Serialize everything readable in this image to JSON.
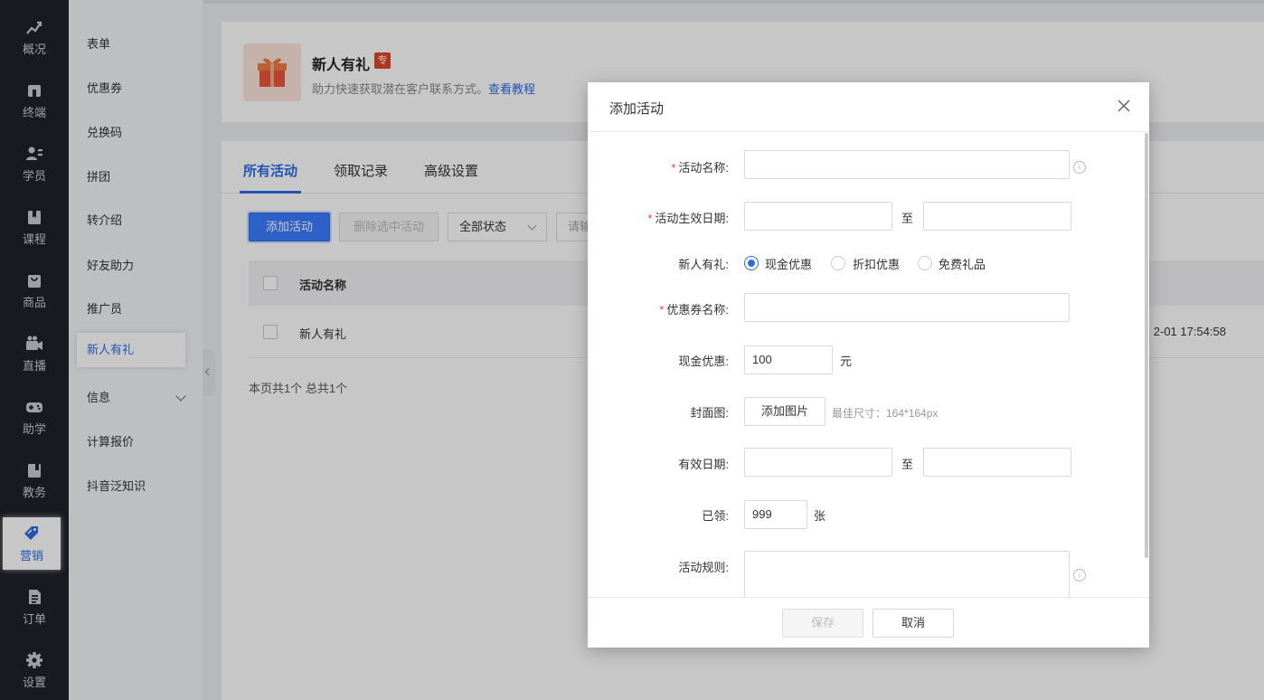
{
  "nav": {
    "items": [
      {
        "label": "概况",
        "icon": "chart-trend-icon"
      },
      {
        "label": "终端",
        "icon": "terminal-icon"
      },
      {
        "label": "学员",
        "icon": "users-icon"
      },
      {
        "label": "课程",
        "icon": "book-icon"
      },
      {
        "label": "商品",
        "icon": "bag-icon"
      },
      {
        "label": "直播",
        "icon": "video-icon"
      },
      {
        "label": "助学",
        "icon": "gamepad-icon"
      },
      {
        "label": "教务",
        "icon": "briefcase-icon"
      },
      {
        "label": "营销",
        "icon": "tag-icon"
      },
      {
        "label": "订单",
        "icon": "document-icon"
      },
      {
        "label": "设置",
        "icon": "gear-icon"
      }
    ],
    "active": "营销"
  },
  "submenu": {
    "items": [
      "表单",
      "优惠券",
      "兑换码",
      "拼团",
      "转介绍",
      "好友助力",
      "推广员",
      "新人有礼",
      "信息",
      "计算报价",
      "抖音泛知识"
    ],
    "active": "新人有礼"
  },
  "header": {
    "title": "新人有礼",
    "badge": "专",
    "desc": "助力快速获取潜在客户联系方式。",
    "link": "查看教程"
  },
  "tabs": [
    "所有活动",
    "领取记录",
    "高级设置"
  ],
  "toolbar": {
    "add": "添加活动",
    "delete": "删除选中活动",
    "status": "全部状态",
    "search_placeholder": "请输"
  },
  "table": {
    "header_name": "活动名称",
    "rows": [
      {
        "name": "新人有礼",
        "time": "2-01 17:54:58"
      }
    ],
    "footer": "本页共1个 总共1个"
  },
  "modal": {
    "title": "添加活动",
    "fields": {
      "name_label": "活动名称:",
      "date_label": "活动生效日期:",
      "date_sep": "至",
      "gift_label": "新人有礼:",
      "gift_options": [
        "现金优惠",
        "折扣优惠",
        "免费礼品"
      ],
      "coupon_label": "优惠券名称:",
      "cash_label": "现金优惠:",
      "cash_value": "100",
      "cash_unit": "元",
      "cover_label": "封面图:",
      "cover_button": "添加图片",
      "cover_hint": "最佳尺寸：164*164px",
      "valid_label": "有效日期:",
      "valid_sep": "至",
      "claimed_label": "已领:",
      "claimed_value": "999",
      "claimed_unit": "张",
      "rules_label": "活动规则:"
    },
    "save": "保存",
    "cancel": "取消"
  }
}
